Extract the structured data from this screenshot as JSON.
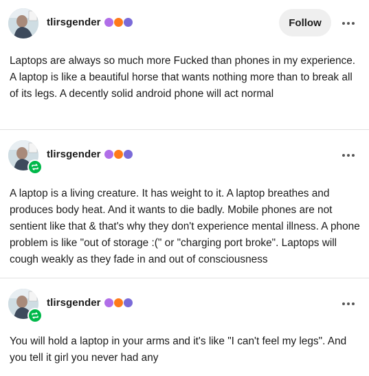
{
  "posts": [
    {
      "username": "tlirsgender",
      "follow_label": "Follow",
      "body": "Laptops are always so much more Fucked than phones in my experience. A laptop is like a beautiful horse that wants nothing more than to break all of its legs. A decently solid android phone will act normal",
      "reblog": false
    },
    {
      "username": "tlirsgender",
      "body": "A laptop is a living creature. It has weight to it. A laptop breathes and produces body heat. And it wants to die badly. Mobile phones are not sentient like that & that's why they don't experience mental illness. A phone problem is like \"out of storage :(\" or \"charging port broke\". Laptops will cough weakly as they fade in and out of consciousness",
      "reblog": true
    },
    {
      "username": "tlirsgender",
      "body": "You will hold a laptop in your arms and it's like \"I can't feel my legs\". And you tell it girl you never had any",
      "reblog": true
    }
  ],
  "colors": {
    "badge_1": "#b06ee8",
    "badge_2": "#ff7a1a",
    "badge_3": "#7a6ad8",
    "reblog_badge": "#00b84a",
    "follow_bg": "#efefef"
  },
  "icons": {
    "avatar": "avatar-photo",
    "badges": [
      "purple-sparkle-badge",
      "orange-paw-badge",
      "purple-face-badge"
    ],
    "reblog": "reblog-icon",
    "more": "ellipsis-icon"
  }
}
